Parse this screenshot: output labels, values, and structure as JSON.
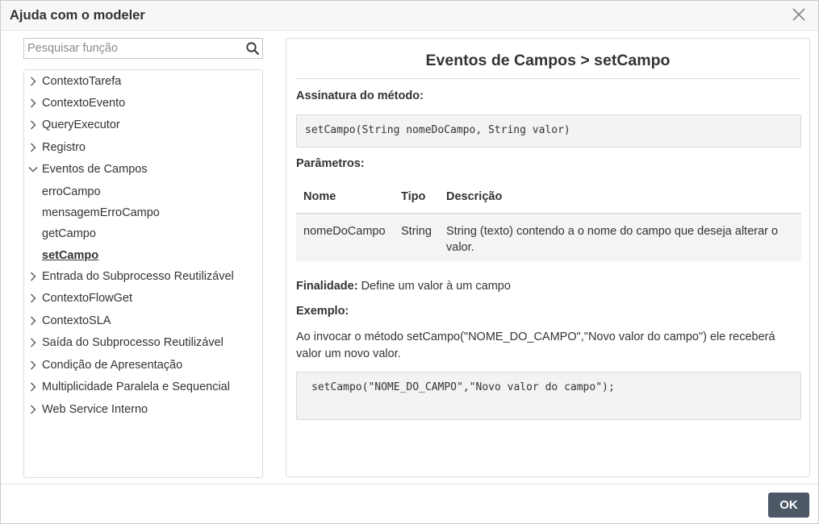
{
  "dialog": {
    "title": "Ajuda com o modeler",
    "ok_label": "OK"
  },
  "search": {
    "placeholder": "Pesquisar função",
    "value": ""
  },
  "tree": {
    "items": [
      {
        "label": "ContextoTarefa",
        "type": "collapsed"
      },
      {
        "label": "ContextoEvento",
        "type": "collapsed"
      },
      {
        "label": "QueryExecutor",
        "type": "collapsed"
      },
      {
        "label": "Registro",
        "type": "collapsed"
      },
      {
        "label": "Eventos de Campos",
        "type": "expanded"
      },
      {
        "label": "erroCampo",
        "type": "child"
      },
      {
        "label": "mensagemErroCampo",
        "type": "child"
      },
      {
        "label": "getCampo",
        "type": "child"
      },
      {
        "label": "setCampo",
        "type": "child-active"
      },
      {
        "label": "Entrada do Subprocesso Reutilizável",
        "type": "collapsed"
      },
      {
        "label": "ContextoFlowGet",
        "type": "collapsed"
      },
      {
        "label": "ContextoSLA",
        "type": "collapsed"
      },
      {
        "label": "Saída do Subprocesso Reutilizável",
        "type": "collapsed"
      },
      {
        "label": "Condição de Apresentação",
        "type": "collapsed"
      },
      {
        "label": "Multiplicidade Paralela e Sequencial",
        "type": "collapsed"
      },
      {
        "label": "Web Service Interno",
        "type": "collapsed"
      }
    ]
  },
  "content": {
    "title": "Eventos de Campos > setCampo",
    "signature_label": "Assinatura do método:",
    "signature": "setCampo(String nomeDoCampo, String valor)",
    "params_label": "Parâmetros:",
    "table": {
      "headers": [
        "Nome",
        "Tipo",
        "Descrição"
      ],
      "rows": [
        [
          "nomeDoCampo",
          "String",
          "String (texto) contendo a o nome do campo que deseja alterar o valor."
        ]
      ]
    },
    "purpose_label": "Finalidade:",
    "purpose_text": " Define um valor à um campo",
    "example_label": "Exemplo:",
    "example_desc": "Ao invocar o método setCampo(\"NOME_DO_CAMPO\",\"Novo valor do campo\") ele receberá valor um novo valor.",
    "example_code": "setCampo(\"NOME_DO_CAMPO\",\"Novo valor do campo\");"
  },
  "icons": {
    "close": "close-icon",
    "search": "search-icon",
    "collapsed": "chevron-right-icon",
    "expanded": "chevron-down-icon"
  },
  "colors": {
    "ok_button": "#4c5866",
    "header_bg": "#f7f7f7",
    "code_bg": "#f3f3f3"
  }
}
